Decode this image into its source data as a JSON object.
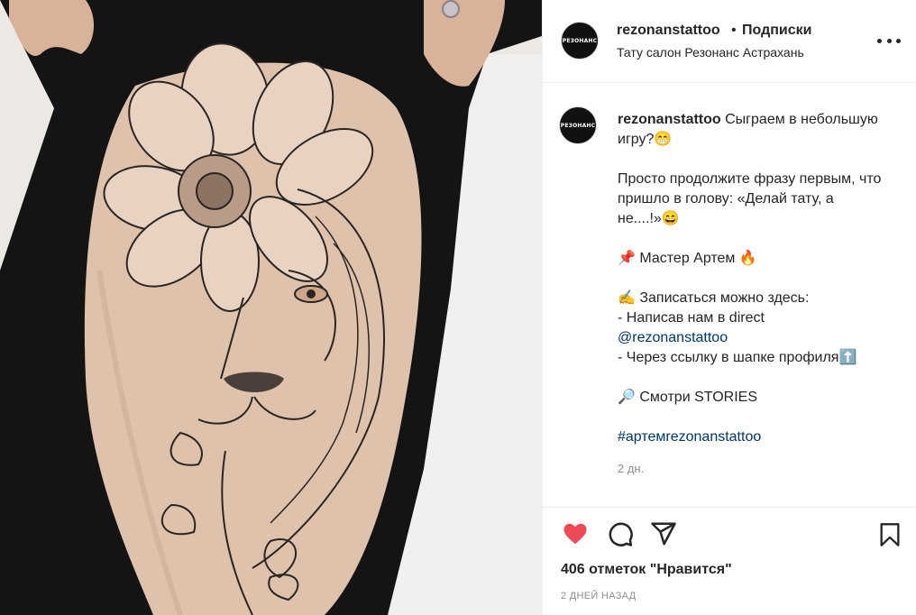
{
  "post": {
    "image_alt": "Tattoo of lion face with flower",
    "colors": {
      "skin": "#e0c4ae",
      "clothing": "#111111",
      "ink": "#2a2522",
      "like": "#ed4956",
      "link": "#00376b",
      "meta": "#8e8e8e"
    }
  },
  "header": {
    "avatar_text": "РЕЗОНАНС",
    "username": "rezonanstattoo",
    "separator": "•",
    "follow_label": "Подписки",
    "location": "Тату салон Резонанс Астрахань",
    "more_icon": "more-horizontal-icon"
  },
  "caption": {
    "username": "rezonanstattoo",
    "line1": "Сыграем в небольшую игру?😁",
    "line2": "Просто продолжите фразу первым, что пришло в голову: «Делай тату, а не....!»😄",
    "line3": "📌 Мастер Артем 🔥",
    "line4": "✍️ Записаться можно здесь:",
    "line5": "- Написав нам в direct",
    "mention": "@rezonanstattoo",
    "line6": "- Через ссылку в шапке профиля⬆️",
    "line7": "🔎 Смотри STORIES",
    "hashtag": "#артемrezonanstattoo",
    "time": "2 дн."
  },
  "actions": {
    "like_icon": "heart-icon",
    "comment_icon": "comment-icon",
    "share_icon": "share-icon",
    "save_icon": "bookmark-icon",
    "likes_text": "406 отметок \"Нравится\"",
    "posted_ago": "2 ДНЕЙ НАЗАД"
  }
}
